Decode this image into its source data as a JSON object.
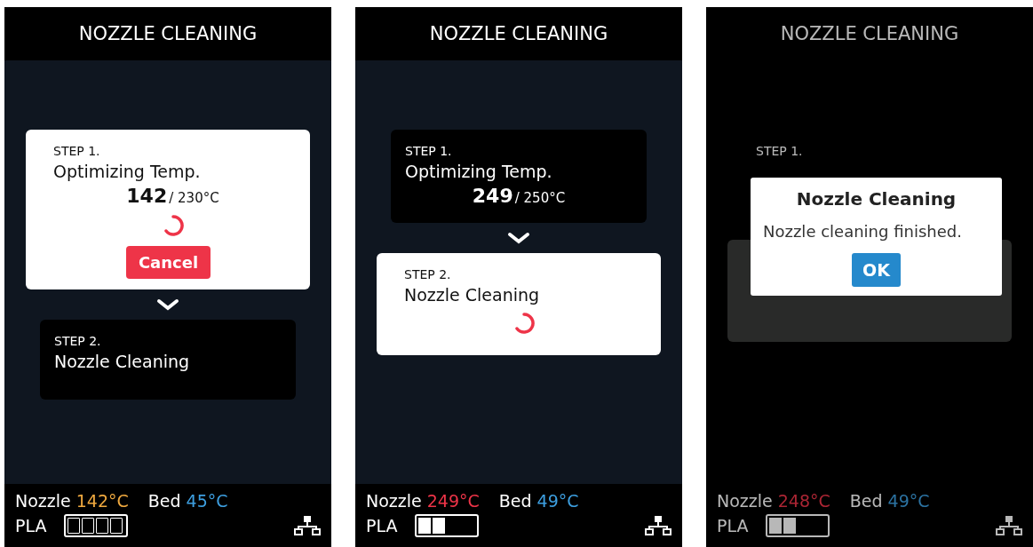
{
  "panels": [
    {
      "title": "NOZZLE CLEANING",
      "dimmed": false,
      "steps": [
        {
          "label": "STEP 1.",
          "title": "Optimizing Temp.",
          "active": true,
          "current": "142",
          "target": "/ 230°C",
          "busy": true,
          "action": "Cancel"
        },
        {
          "label": "STEP 2.",
          "title": "Nozzle Cleaning",
          "active": false,
          "busy": false
        }
      ],
      "footer": {
        "nozzle_label": "Nozzle",
        "nozzle_temp": "142°C",
        "hot": false,
        "bed_label": "Bed",
        "bed_temp": "45°C",
        "material": "PLA",
        "empty": true
      }
    },
    {
      "title": "NOZZLE CLEANING",
      "dimmed": false,
      "steps": [
        {
          "label": "STEP 1.",
          "title": "Optimizing Temp.",
          "active": false,
          "current": "249",
          "target": " / 250°C",
          "busy": false
        },
        {
          "label": "STEP 2.",
          "title": "Nozzle Cleaning",
          "active": true,
          "busy": true
        }
      ],
      "footer": {
        "nozzle_label": "Nozzle",
        "nozzle_temp": "249°C",
        "hot": true,
        "bed_label": "Bed",
        "bed_temp": "49°C",
        "material": "PLA",
        "level": 0.5
      }
    },
    {
      "title": "NOZZLE CLEANING",
      "dimmed": true,
      "steps": [
        {
          "label": "STEP 1.",
          "active": false,
          "busy": false
        },
        {
          "active": true
        }
      ],
      "footer": {
        "nozzle_label": "Nozzle",
        "nozzle_temp": "248°C",
        "hot": true,
        "bed_label": "Bed",
        "bed_temp": "49°C",
        "material": "PLA",
        "level": 0.5
      },
      "dialog": {
        "title": "Nozzle Cleaning",
        "message": "Nozzle cleaning finished.",
        "button": "OK"
      }
    }
  ]
}
